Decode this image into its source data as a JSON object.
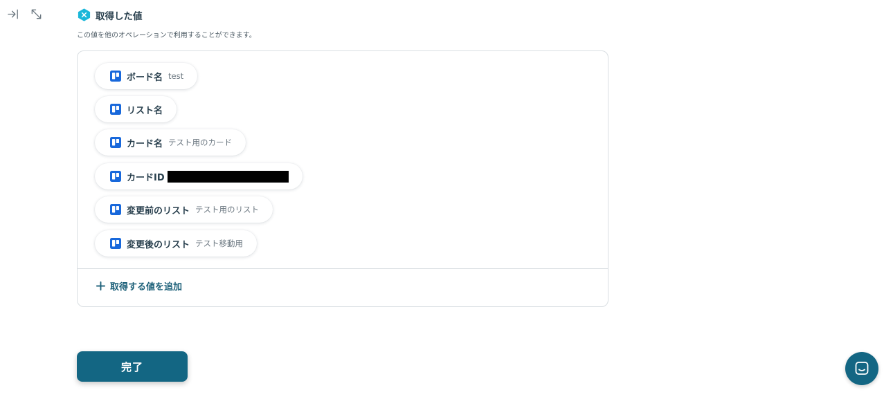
{
  "toolbar": {
    "icons": [
      "collapse-panel-icon",
      "expand-icon"
    ]
  },
  "section": {
    "title": "取得した値",
    "description": "この値を他のオペレーションで利用することができます。"
  },
  "values": [
    {
      "label": "ボード名",
      "value": "test"
    },
    {
      "label": "リスト名",
      "value": ""
    },
    {
      "label": "カード名",
      "value": "テスト用のカード"
    },
    {
      "label": "カードID",
      "value": ""
    },
    {
      "label": "変更前のリスト",
      "value": "テスト用のリスト"
    },
    {
      "label": "変更後のリスト",
      "value": "テスト移動用"
    }
  ],
  "add_value_label": "取得する値を追加",
  "done_label": "完了",
  "colors": {
    "accent": "#136683",
    "trello_blue": "#1868db",
    "badge": "#1ab7d9",
    "text": "#283f4d"
  }
}
